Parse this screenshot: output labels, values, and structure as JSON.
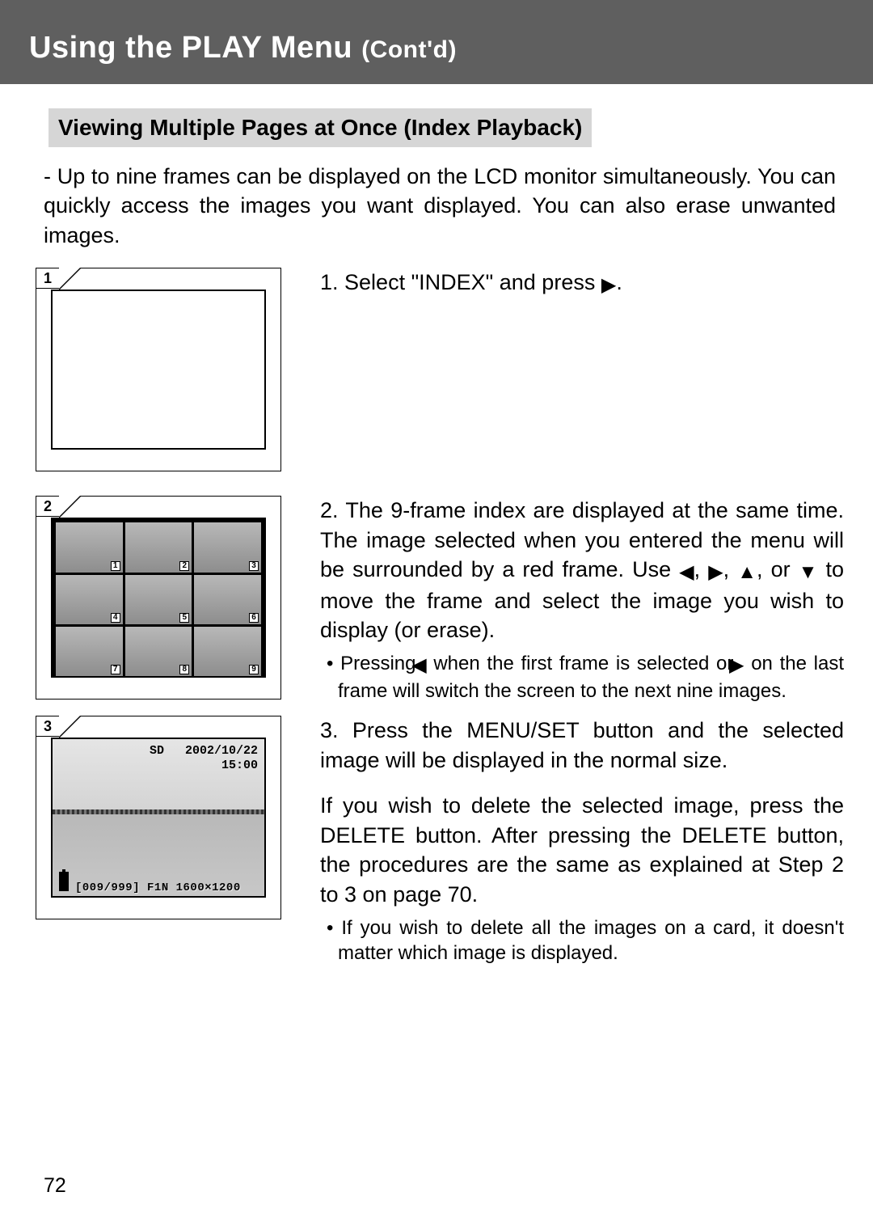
{
  "header": {
    "title_main": "Using the PLAY Menu",
    "title_cont": "(Cont'd)"
  },
  "section": {
    "title": "Viewing Multiple Pages at Once (Index Playback)"
  },
  "intro": "Up to nine frames can be displayed on the LCD monitor simultaneously. You can quickly access the images you want displayed.  You can also erase unwanted images.",
  "figures": {
    "f1": {
      "num": "1"
    },
    "f2": {
      "num": "2",
      "thumb_labels": [
        "1",
        "2",
        "3",
        "4",
        "5",
        "6",
        "7",
        "8",
        "9"
      ]
    },
    "f3": {
      "num": "3",
      "overlay": {
        "sd": "SD",
        "date": "2002/10/22",
        "time": "15:00",
        "info": "[009/999]   F1N   1600×1200"
      }
    }
  },
  "steps": {
    "s1": {
      "prefix": "1.  ",
      "text_a": "Select \"INDEX\" and press ",
      "text_b": "."
    },
    "s2": {
      "prefix": "2.  ",
      "text_a": "The 9-frame index are displayed at the same time. The image selected when you entered the menu will be surrounded by a red frame. Use ",
      "text_b": ", ",
      "text_c": ", ",
      "text_d": ", or ",
      "text_e": " to move the frame and select the image you wish to display (or erase).",
      "bullet_a": "Pressing ",
      "bullet_b": " when the first frame is selected or ",
      "bullet_c": " on the last frame will switch the screen to the next nine images."
    },
    "s3": {
      "prefix": "3.  ",
      "text": "Press the MENU/SET button and the selected image will be displayed in the normal size.",
      "para2": "If you wish to delete the selected image, press the DELETE button. After pressing the DELETE button, the procedures are the same as explained at Step 2 to 3 on page 70.",
      "bullet": "If you wish to delete all the images on a card, it doesn't matter which image is displayed."
    }
  },
  "glyphs": {
    "left": "◀",
    "right": "▶",
    "up": "▲",
    "down": "▼"
  },
  "page_number": "72"
}
